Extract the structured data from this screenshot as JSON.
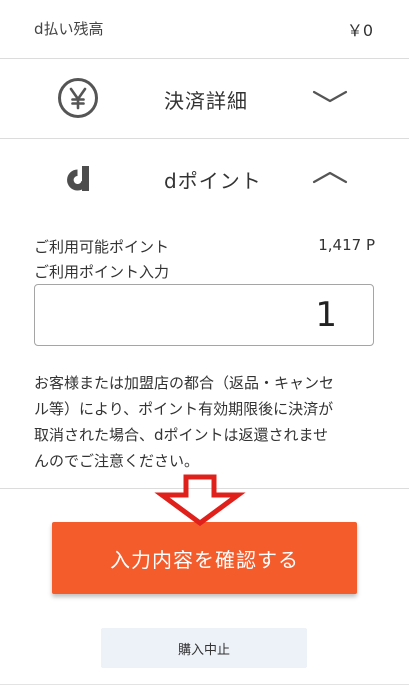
{
  "balance": {
    "label": "d払い残高",
    "value": "￥0"
  },
  "sections": {
    "settlement": {
      "label": "決済詳細",
      "icon": "yen-icon",
      "state": "collapsed"
    },
    "dpoint": {
      "label": "dポイント",
      "icon": "d-logo-icon",
      "state": "expanded"
    }
  },
  "points": {
    "available_label": "ご利用可能ポイント",
    "available_value": "1,417 P",
    "input_label": "ご利用ポイント入力",
    "input_value": "1"
  },
  "notice_lines": [
    "お客様または加盟店の都合（返品・キャンセ",
    "ル等）により、ポイント有効期限後に決済が",
    "取消された場合、dポイントは返還されませ",
    "んのでご注意ください。"
  ],
  "actions": {
    "confirm_label": "入力内容を確認する",
    "cancel_label": "購入中止"
  },
  "colors": {
    "confirm_bg": "#f45c2c",
    "cancel_bg": "#edf1f8",
    "annotation_arrow": "#e0201b"
  }
}
